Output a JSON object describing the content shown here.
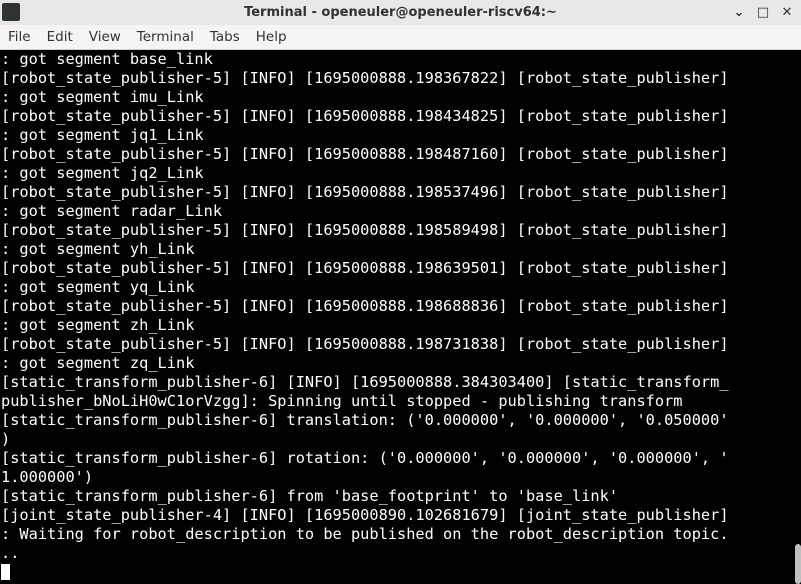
{
  "window": {
    "title": "Terminal - openeuler@openeuler-riscv64:~",
    "controls": {
      "minimize": "⌄",
      "maximize": "□",
      "close": "✕"
    }
  },
  "menubar": {
    "items": [
      "File",
      "Edit",
      "View",
      "Terminal",
      "Tabs",
      "Help"
    ]
  },
  "terminal": {
    "lines": [
      ": got segment base_link",
      "[robot_state_publisher-5] [INFO] [1695000888.198367822] [robot_state_publisher]",
      ": got segment imu_Link",
      "[robot_state_publisher-5] [INFO] [1695000888.198434825] [robot_state_publisher]",
      ": got segment jq1_Link",
      "[robot_state_publisher-5] [INFO] [1695000888.198487160] [robot_state_publisher]",
      ": got segment jq2_Link",
      "[robot_state_publisher-5] [INFO] [1695000888.198537496] [robot_state_publisher]",
      ": got segment radar_Link",
      "[robot_state_publisher-5] [INFO] [1695000888.198589498] [robot_state_publisher]",
      ": got segment yh_Link",
      "[robot_state_publisher-5] [INFO] [1695000888.198639501] [robot_state_publisher]",
      ": got segment yq_Link",
      "[robot_state_publisher-5] [INFO] [1695000888.198688836] [robot_state_publisher]",
      ": got segment zh_Link",
      "[robot_state_publisher-5] [INFO] [1695000888.198731838] [robot_state_publisher]",
      ": got segment zq_Link",
      "[static_transform_publisher-6] [INFO] [1695000888.384303400] [static_transform_",
      "publisher_bNoLiH0wC1orVzgg]: Spinning until stopped - publishing transform",
      "[static_transform_publisher-6] translation: ('0.000000', '0.000000', '0.050000'",
      ")",
      "[static_transform_publisher-6] rotation: ('0.000000', '0.000000', '0.000000', '",
      "1.000000')",
      "[static_transform_publisher-6] from 'base_footprint' to 'base_link'",
      "[joint_state_publisher-4] [INFO] [1695000890.102681679] [joint_state_publisher]",
      ": Waiting for robot_description to be published on the robot_description topic.",
      ".."
    ]
  }
}
